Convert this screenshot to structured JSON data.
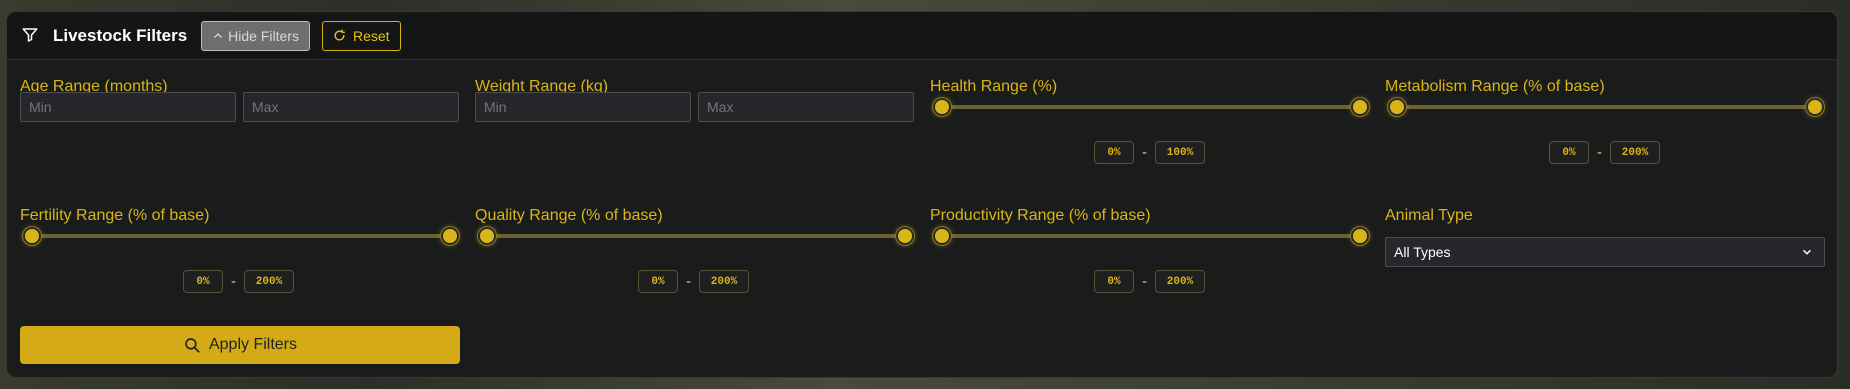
{
  "header": {
    "title": "Livestock Filters",
    "hide_label": "Hide Filters",
    "reset_label": "Reset"
  },
  "filters": {
    "age": {
      "label": "Age Range (months)",
      "min_placeholder": "Min",
      "max_placeholder": "Max"
    },
    "weight": {
      "label": "Weight Range (kg)",
      "min_placeholder": "Min",
      "max_placeholder": "Max"
    },
    "health": {
      "label": "Health Range (%)",
      "low": "0%",
      "high": "100%",
      "low_frac": 0,
      "high_frac": 1
    },
    "metabolism": {
      "label": "Metabolism Range (% of base)",
      "low": "0%",
      "high": "200%",
      "low_frac": 0,
      "high_frac": 1
    },
    "fertility": {
      "label": "Fertility Range (% of base)",
      "low": "0%",
      "high": "200%",
      "low_frac": 0,
      "high_frac": 1
    },
    "quality": {
      "label": "Quality Range (% of base)",
      "low": "0%",
      "high": "200%",
      "low_frac": 0,
      "high_frac": 1
    },
    "productivity": {
      "label": "Productivity Range (% of base)",
      "low": "0%",
      "high": "200%",
      "low_frac": 0,
      "high_frac": 1
    },
    "animal_type": {
      "label": "Animal Type",
      "selected": "All Types"
    }
  },
  "apply_label": "Apply Filters",
  "colors": {
    "accent": "#d9b51a",
    "panel": "#1a1c1c",
    "button": "#d4ab16"
  },
  "icons": {
    "filter": "funnel-icon",
    "hide": "chevron-up-icon",
    "reset": "refresh-icon",
    "apply": "search-icon",
    "select": "chevron-down-icon"
  }
}
